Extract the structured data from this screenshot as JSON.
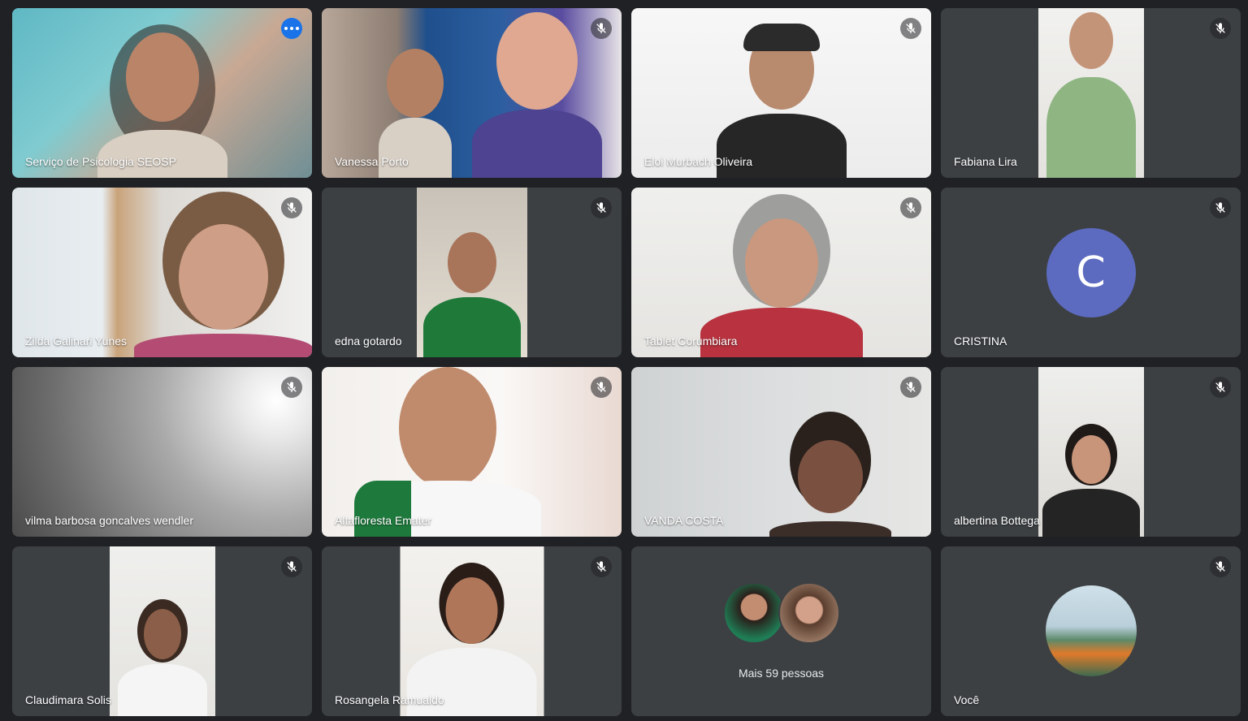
{
  "colors": {
    "background": "#202124",
    "tile": "#3c4043",
    "active_outline": "#8ab4f8",
    "more_button": "#1a73e8",
    "avatar_c": "#5c6bc0"
  },
  "participants": [
    {
      "name": "Serviço de Psicologia SEOSP",
      "muted": false,
      "active": true
    },
    {
      "name": "Vanessa Porto",
      "muted": true
    },
    {
      "name": "Eloi Murbach Oliveira",
      "muted": true
    },
    {
      "name": "Fabiana Lira",
      "muted": true
    },
    {
      "name": "Zilda Galinari Yunes",
      "muted": true
    },
    {
      "name": "edna gotardo",
      "muted": true
    },
    {
      "name": "Tablet Corumbiara",
      "muted": true
    },
    {
      "name": "CRISTINA",
      "muted": true,
      "avatar_letter": "C"
    },
    {
      "name": "vilma barbosa goncalves wendler",
      "muted": true
    },
    {
      "name": "Altafloresta Emater",
      "muted": true
    },
    {
      "name": "VANDA COSTA",
      "muted": true
    },
    {
      "name": "albertina Bottega",
      "muted": true
    },
    {
      "name": "Claudimara Solis",
      "muted": true
    },
    {
      "name": "Rosangela Ramualdo",
      "muted": true
    }
  ],
  "more_tile": {
    "label": "Mais 59 pessoas"
  },
  "self_tile": {
    "name": "Você",
    "muted": true
  },
  "icons": {
    "mic_off": "mic-off-icon",
    "more_options": "more-options-icon"
  }
}
